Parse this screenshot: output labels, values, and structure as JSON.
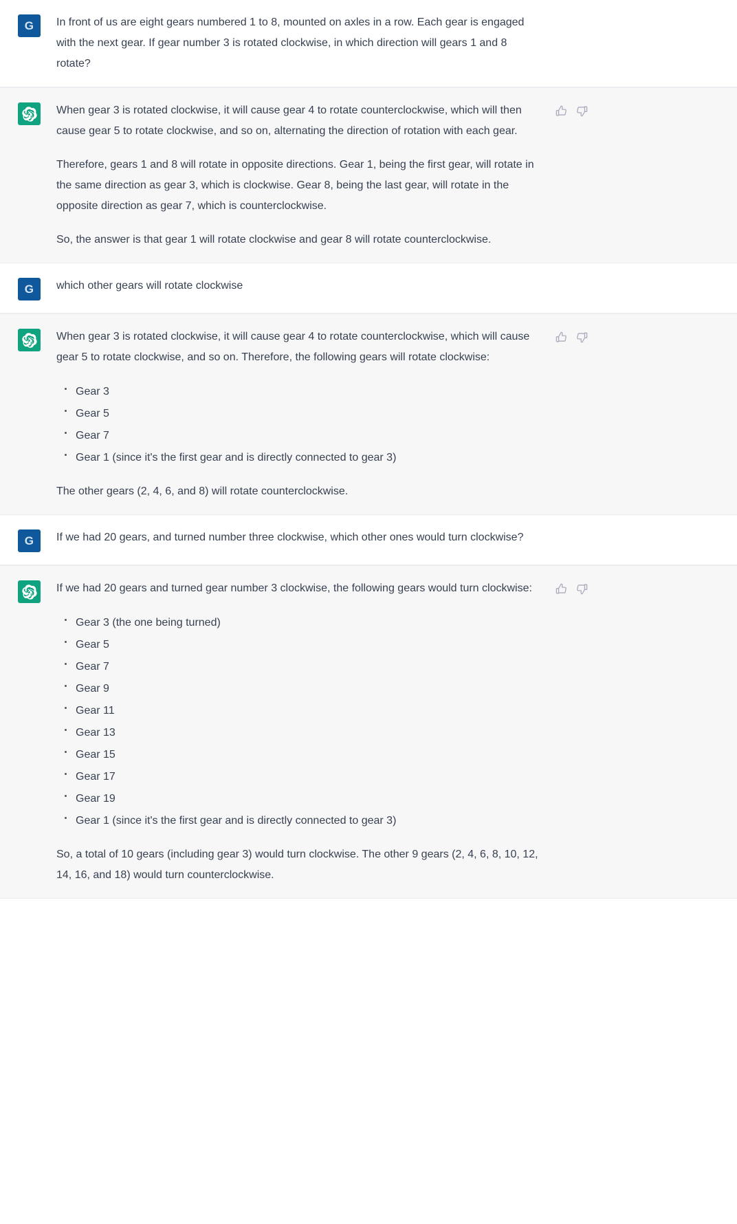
{
  "app": {
    "user_avatar_initial": "G",
    "assistant_avatar_icon": "openai-logo-icon",
    "accent_user": "#10589c",
    "accent_assistant": "#10a37f",
    "background_user": "#ffffff",
    "background_assistant": "#f7f7f8",
    "text_color": "#374151"
  },
  "actions": {
    "thumbs_up_label": "thumbs-up",
    "thumbs_down_label": "thumbs-down"
  },
  "conversation": [
    {
      "role": "user",
      "paragraphs": [
        "In front of us are eight gears numbered 1 to 8, mounted on axles in a row. Each gear is engaged with the next gear. If gear number 3 is rotated clockwise, in which direction will gears 1 and 8 rotate?"
      ]
    },
    {
      "role": "assistant",
      "paragraphs": [
        "When gear 3 is rotated clockwise, it will cause gear 4 to rotate counterclockwise, which will then cause gear 5 to rotate clockwise, and so on, alternating the direction of rotation with each gear.",
        "Therefore, gears 1 and 8 will rotate in opposite directions. Gear 1, being the first gear, will rotate in the same direction as gear 3, which is clockwise. Gear 8, being the last gear, will rotate in the opposite direction as gear 7, which is counterclockwise.",
        "So, the answer is that gear 1 will rotate clockwise and gear 8 will rotate counterclockwise."
      ]
    },
    {
      "role": "user",
      "paragraphs": [
        "which other gears will rotate clockwise"
      ]
    },
    {
      "role": "assistant",
      "intro": "When gear 3 is rotated clockwise, it will cause gear 4 to rotate counterclockwise, which will cause gear 5 to rotate clockwise, and so on. Therefore, the following gears will rotate clockwise:",
      "bullets": [
        "Gear 3",
        "Gear 5",
        "Gear 7",
        "Gear 1 (since it's the first gear and is directly connected to gear 3)"
      ],
      "outro": "The other gears (2, 4, 6, and 8) will rotate counterclockwise."
    },
    {
      "role": "user",
      "paragraphs": [
        "If we had 20 gears, and turned number three clockwise, which other ones would turn clockwise?"
      ]
    },
    {
      "role": "assistant",
      "intro": "If we had 20 gears and turned gear number 3 clockwise, the following gears would turn clockwise:",
      "bullets": [
        "Gear 3 (the one being turned)",
        "Gear 5",
        "Gear 7",
        "Gear 9",
        "Gear 11",
        "Gear 13",
        "Gear 15",
        "Gear 17",
        "Gear 19",
        "Gear 1 (since it's the first gear and is directly connected to gear 3)"
      ],
      "outro": "So, a total of 10 gears (including gear 3) would turn clockwise. The other 9 gears (2, 4, 6, 8, 10, 12, 14, 16, and 18) would turn counterclockwise."
    }
  ]
}
